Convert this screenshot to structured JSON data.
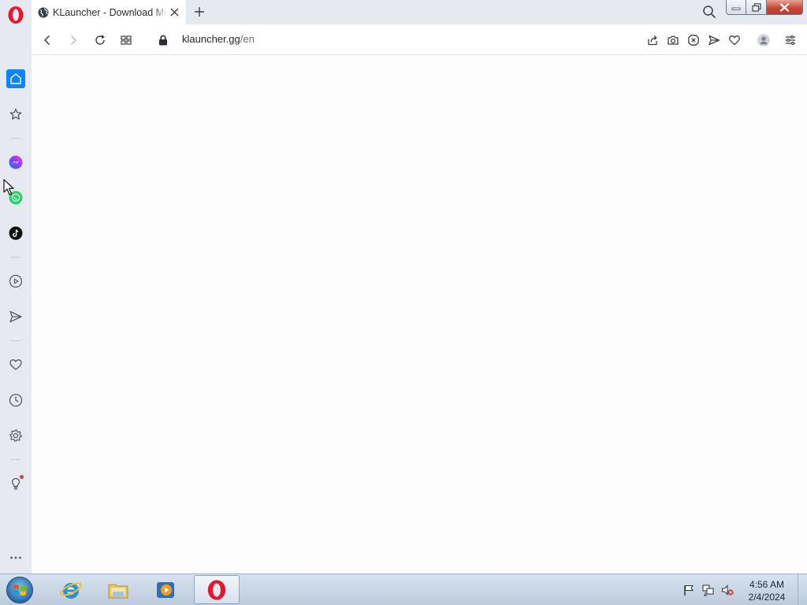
{
  "browser": {
    "tab": {
      "title": "KLauncher - Download Minecraft Launcher",
      "url_domain": "klauncher.gg",
      "url_path": "/en"
    }
  },
  "sidebar": {
    "items": [
      "home-icon",
      "star-icon",
      "messenger-icon",
      "whatsapp-icon",
      "tiktok-icon",
      "player-icon",
      "send-icon",
      "heart-icon",
      "history-icon",
      "settings-icon",
      "tips-icon",
      "more-icon"
    ]
  },
  "colors": {
    "accent": "#0a84ff",
    "opera_red": "#e8162c",
    "page_bg": "#fcfcfd",
    "sidebar_bg": "#e6eaf0"
  },
  "taskbar": {
    "clock": {
      "time": "4:56 AM",
      "date": "2/4/2024"
    }
  }
}
